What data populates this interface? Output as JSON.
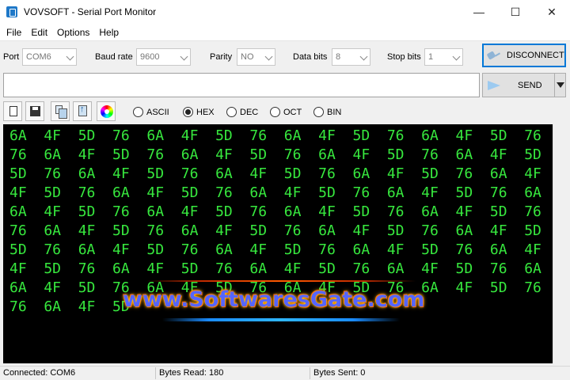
{
  "window": {
    "title": "VOVSOFT - Serial Port Monitor",
    "controls": {
      "minimize": "—",
      "maximize": "☐",
      "close": "✕"
    }
  },
  "menu": [
    "File",
    "Edit",
    "Options",
    "Help"
  ],
  "settings": {
    "port_label": "Port",
    "port_value": "COM6",
    "baud_label": "Baud rate",
    "baud_value": "9600",
    "parity_label": "Parity",
    "parity_value": "NO",
    "databits_label": "Data bits",
    "databits_value": "8",
    "stopbits_label": "Stop bits",
    "stopbits_value": "1"
  },
  "connection": {
    "disconnect_label": "DISCONNECT"
  },
  "send": {
    "input_value": "",
    "button_label": "SEND"
  },
  "toolbar": {
    "icons": [
      "new-document-icon",
      "save-icon",
      "copy-icon",
      "export-icon",
      "color-wheel-icon"
    ]
  },
  "format": {
    "options": [
      "ASCII",
      "HEX",
      "DEC",
      "OCT",
      "BIN"
    ],
    "selected": "HEX"
  },
  "output": {
    "lines": [
      "6A  4F  5D  76  6A  4F  5D  76  6A  4F  5D  76  6A  4F  5D  76  6A  4F  5D",
      "76  6A  4F  5D  76  6A  4F  5D  76  6A  4F  5D  76  6A  4F  5D  76  6A  4F",
      "5D  76  6A  4F  5D  76  6A  4F  5D  76  6A  4F  5D  76  6A  4F  5D  76  6A",
      "4F  5D  76  6A  4F  5D  76  6A  4F  5D  76  6A  4F  5D  76  6A  4F  5D  76",
      "6A  4F  5D  76  6A  4F  5D  76  6A  4F  5D  76  6A  4F  5D  76  6A  4F  5D",
      "76  6A  4F  5D  76  6A  4F  5D  76  6A  4F  5D  76  6A  4F  5D  76  6A  4F",
      "5D  76  6A  4F  5D  76  6A  4F  5D  76  6A  4F  5D  76  6A  4F  5D  76  6A",
      "4F  5D  76  6A  4F  5D  76  6A  4F  5D  76  6A  4F  5D  76  6A  4F  5D  76",
      "6A  4F  5D  76  6A  4F  5D  76  6A  4F  5D  76  6A  4F  5D  76  6A  4F  5D",
      "76  6A  4F  5D"
    ],
    "text_color": "#37e83e",
    "background": "#000000"
  },
  "watermark": {
    "text": "www.SoftwaresGate.com"
  },
  "status": {
    "connected": "Connected: COM6",
    "bytes_read": "Bytes Read: 180",
    "bytes_sent": "Bytes Sent: 0"
  }
}
